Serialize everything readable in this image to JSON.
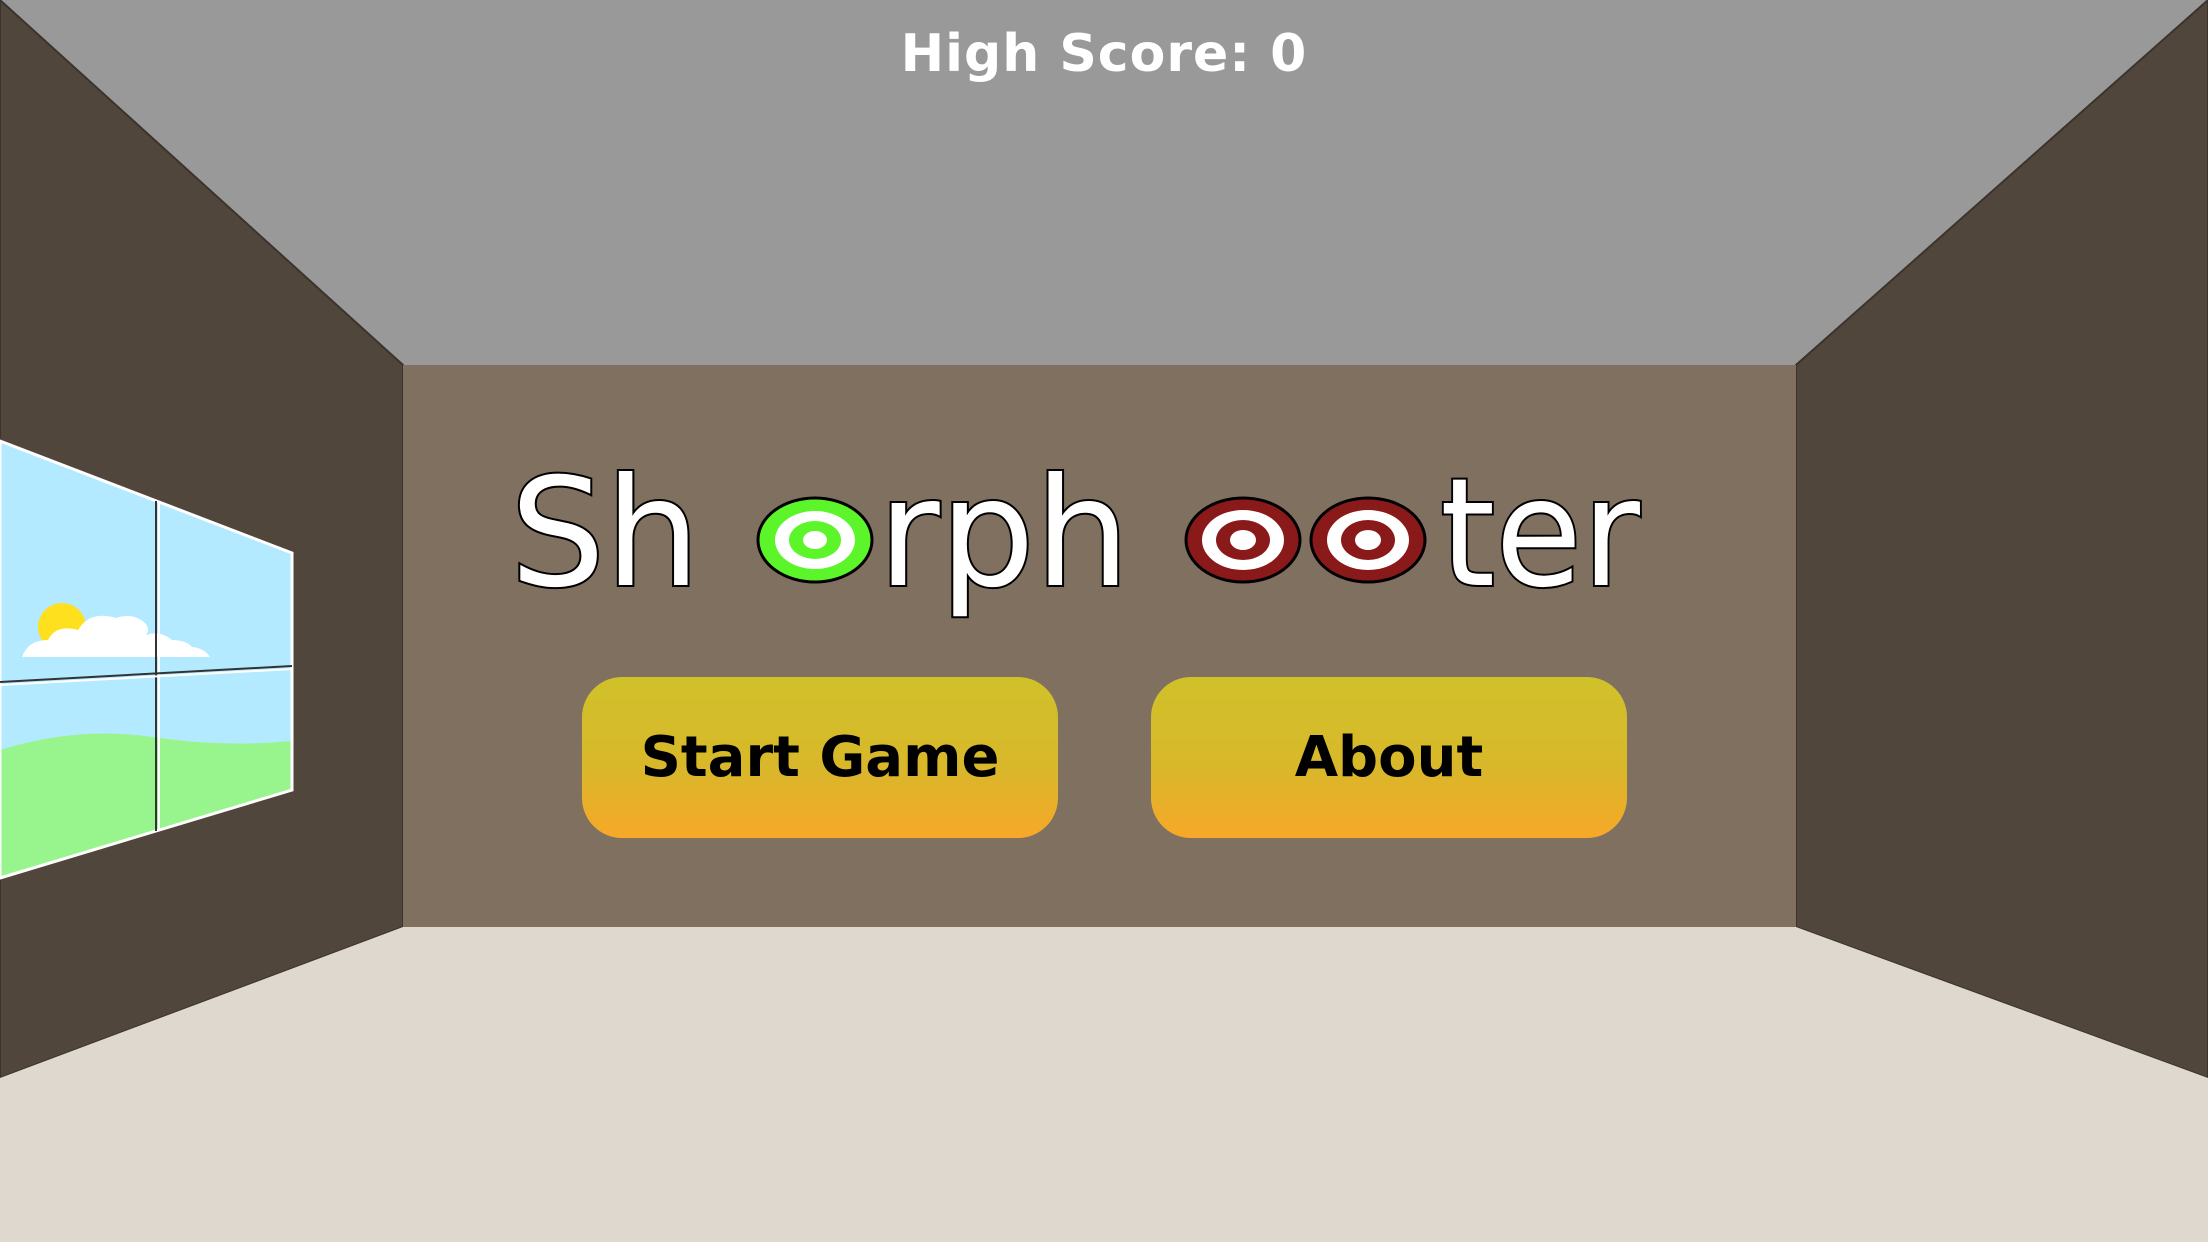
{
  "hud": {
    "high_score_label": "High Score:",
    "high_score_value": "0",
    "high_score_text": "High Score: 0"
  },
  "logo": {
    "text": "Shorphooter",
    "target_colors": {
      "green": "#5cf52a",
      "red": "#8a1a1a"
    }
  },
  "menu": {
    "start_label": "Start Game",
    "about_label": "About"
  },
  "colors": {
    "ceiling": "#999999",
    "side_walls": "#50463c",
    "back_wall": "#807060",
    "floor": "#dfd8cf",
    "sky": "#b4eaff",
    "grass": "#98f58e",
    "sun": "#ffe01e"
  }
}
